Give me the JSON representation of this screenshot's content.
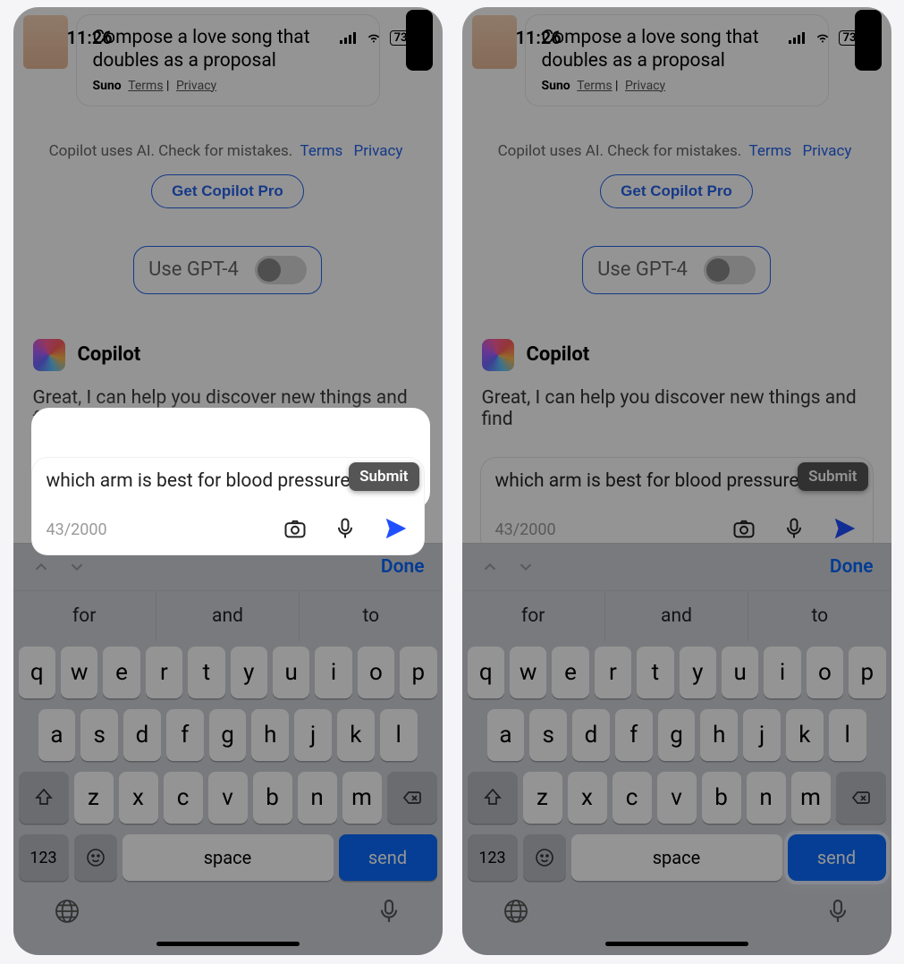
{
  "status": {
    "time": "11:26",
    "battery": "73"
  },
  "suggestion": {
    "title": "Compose a love song that doubles as a proposal",
    "provider": "Suno",
    "terms": "Terms",
    "privacy": "Privacy"
  },
  "disclaimer": {
    "text": "Copilot uses AI. Check for mistakes.",
    "terms": "Terms",
    "privacy": "Privacy",
    "pro": "Get Copilot Pro",
    "gpt": "Use GPT-4"
  },
  "copilot": {
    "name": "Copilot",
    "msg": "Great, I can help you discover new things and find"
  },
  "input": {
    "value": "which arm is best for blood pressure ch",
    "counter": "43/2000",
    "submit": "Submit"
  },
  "kb": {
    "done": "Done",
    "sugg": [
      "for",
      "and",
      "to"
    ],
    "r1": [
      "q",
      "w",
      "e",
      "r",
      "t",
      "y",
      "u",
      "i",
      "o",
      "p"
    ],
    "r2": [
      "a",
      "s",
      "d",
      "f",
      "g",
      "h",
      "j",
      "k",
      "l"
    ],
    "r3": [
      "z",
      "x",
      "c",
      "v",
      "b",
      "n",
      "m"
    ],
    "num": "123",
    "space": "space",
    "send": "send"
  }
}
